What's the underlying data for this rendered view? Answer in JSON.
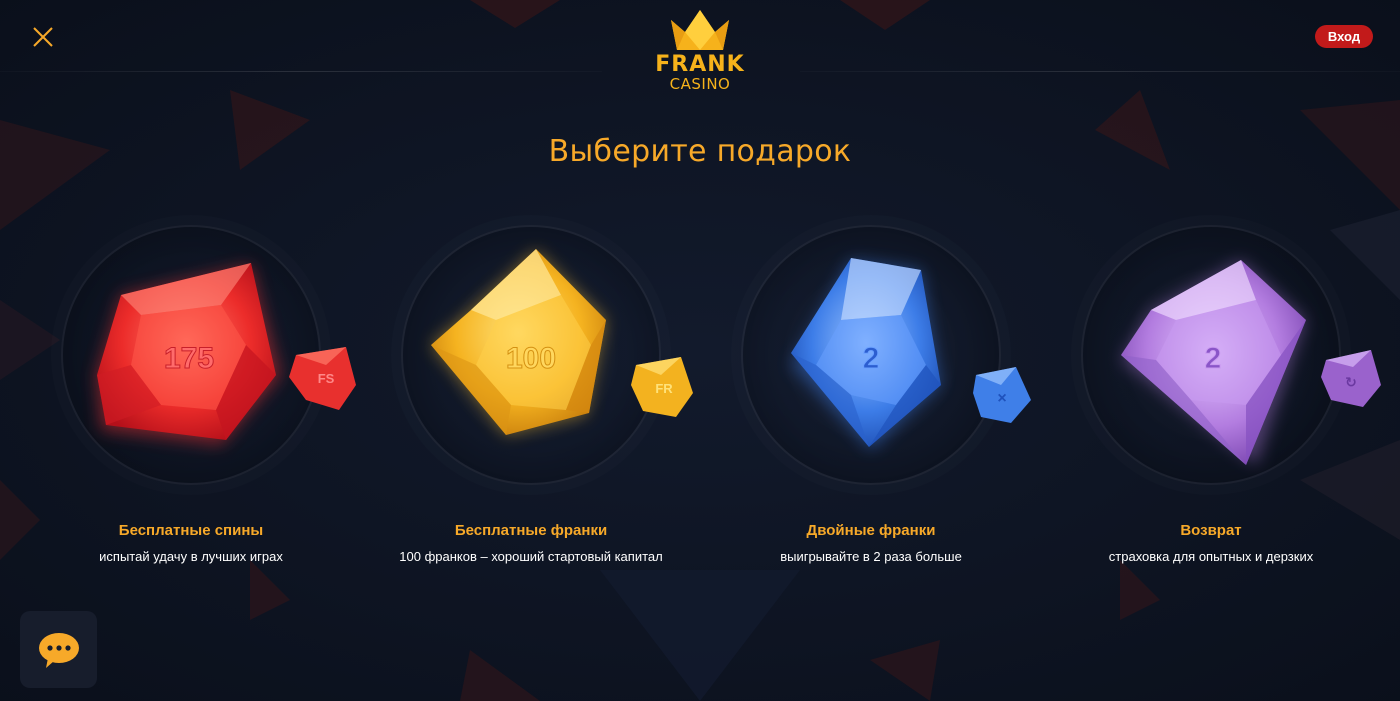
{
  "header": {
    "close_icon": "close-icon",
    "logo": {
      "brand": "FRANK",
      "sub": "CASINO",
      "icon": "crown-icon"
    },
    "login_label": "Вход"
  },
  "main": {
    "title": "Выберите подарок",
    "gifts": [
      {
        "value": "175",
        "badge": "FS",
        "title": "Бесплатные спины",
        "description": "испытай удачу в лучших играх",
        "color": "#e8302e"
      },
      {
        "value": "100",
        "badge": "FR",
        "title": "Бесплатные франки",
        "description": "100 франков – хороший стартовый капитал",
        "color": "#f3b21f"
      },
      {
        "value": "2",
        "badge": "×",
        "title": "Двойные франки",
        "description": "выигрывайте в 2 раза больше",
        "color": "#3f7fe8"
      },
      {
        "value": "2",
        "badge": "↻",
        "title": "Возврат",
        "description": "страховка для опытных и дерзких",
        "color": "#b37de0"
      }
    ]
  },
  "chat": {
    "icon": "chat-bubble-icon"
  },
  "colors": {
    "accent": "#f7a929",
    "login": "#c21a1a",
    "background": "#0e1422"
  }
}
